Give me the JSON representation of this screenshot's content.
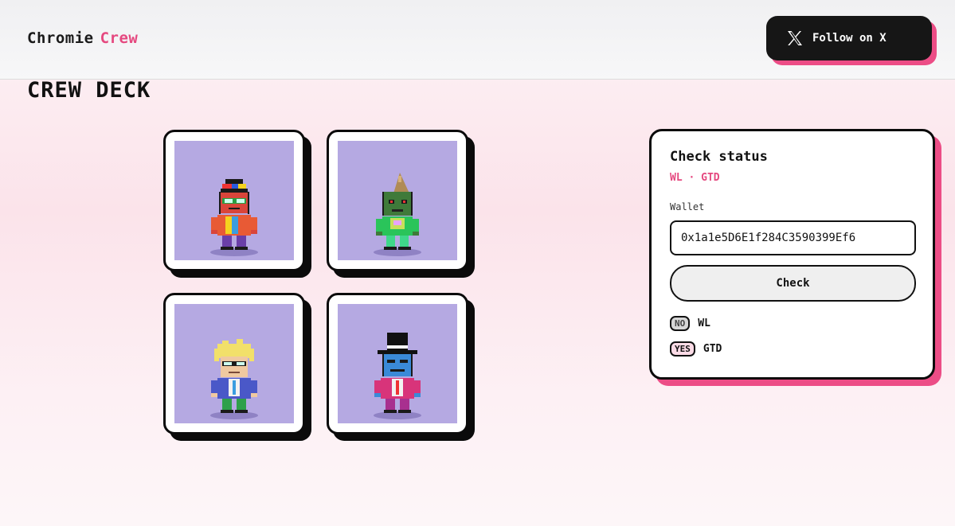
{
  "header": {
    "logo_part1": "Chromie",
    "logo_part2": "Crew",
    "follow_label": "Follow on X"
  },
  "page": {
    "title": "CREW DECK"
  },
  "deck": {
    "cards": [
      {
        "name": "propeller-cap-character"
      },
      {
        "name": "green-cone-hat-character"
      },
      {
        "name": "blonde-glasses-character"
      },
      {
        "name": "top-hat-character"
      }
    ]
  },
  "status_panel": {
    "title": "Check status",
    "subtitle": "WL · GTD",
    "wallet_label": "Wallet",
    "wallet_value": "0x1a1e5D6E1f284C3590399Ef6",
    "check_label": "Check",
    "results": [
      {
        "badge": "NO",
        "label": "WL"
      },
      {
        "badge": "YES",
        "label": "GTD"
      }
    ]
  },
  "colors": {
    "accent": "#ec4d86",
    "card_bg": "#b5a9e2",
    "dark": "#0b0b0b"
  }
}
